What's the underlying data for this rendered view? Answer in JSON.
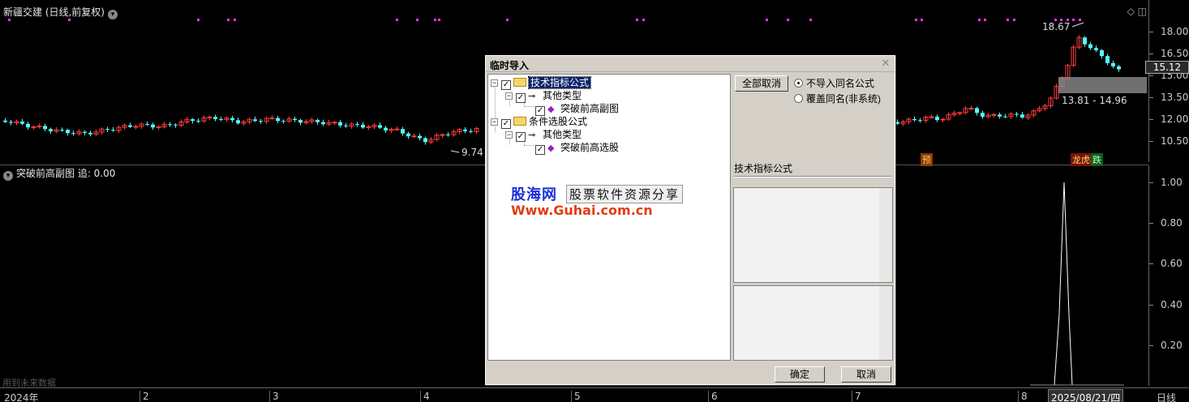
{
  "chart": {
    "title": "新疆交建 (日线,前复权)",
    "price_ticks": [
      "18.00",
      "16.50",
      "15.00",
      "13.50",
      "12.00",
      "10.50"
    ],
    "current_price": "15.12",
    "high_label": "18.67",
    "low_label": "9.74",
    "range_label": "13.81 - 14.96",
    "marker_pre": "预",
    "marker_list": "龙虎榜",
    "marker_fall": "跌"
  },
  "indicator": {
    "title": "突破前高副图  追: 0.00",
    "ticks": [
      "1.00",
      "0.80",
      "0.60",
      "0.40",
      "0.20"
    ],
    "future_note": "用到未来数据"
  },
  "date_axis": {
    "labels": [
      "2024年",
      "2",
      "3",
      "4",
      "5",
      "6",
      "7",
      "8"
    ],
    "cursor": "2025/08/21/四",
    "period": "日线"
  },
  "colors": {
    "up": "#ff3b3b",
    "down": "#54ffff",
    "signal": "#ff33ff"
  },
  "dialog": {
    "title": "临时导入",
    "close_icon": "close-icon",
    "tree": [
      {
        "label": "技术指标公式",
        "level": 0,
        "checked": true,
        "selected": true,
        "icon": "folder-icon"
      },
      {
        "label": "其他类型",
        "level": 1,
        "checked": true,
        "icon": "key-icon"
      },
      {
        "label": "突破前高副图",
        "level": 2,
        "checked": true,
        "icon": "gem-icon"
      },
      {
        "label": "条件选股公式",
        "level": 0,
        "checked": true,
        "icon": "folder-icon"
      },
      {
        "label": "其他类型",
        "level": 1,
        "checked": true,
        "icon": "key-icon"
      },
      {
        "label": "突破前高选股",
        "level": 2,
        "checked": true,
        "icon": "gem-icon"
      }
    ],
    "watermark": {
      "brand": "股海网",
      "slogan": "股票软件资源分享",
      "url": "Www.Guhai.com.cn"
    },
    "cancel_all_label": "全部取消",
    "radio_options": [
      {
        "label": "不导入同名公式",
        "selected": true
      },
      {
        "label": "覆盖同名(非系统)",
        "selected": false
      }
    ],
    "info_label": "技术指标公式",
    "ok_label": "确定",
    "cancel_label": "取消"
  }
}
